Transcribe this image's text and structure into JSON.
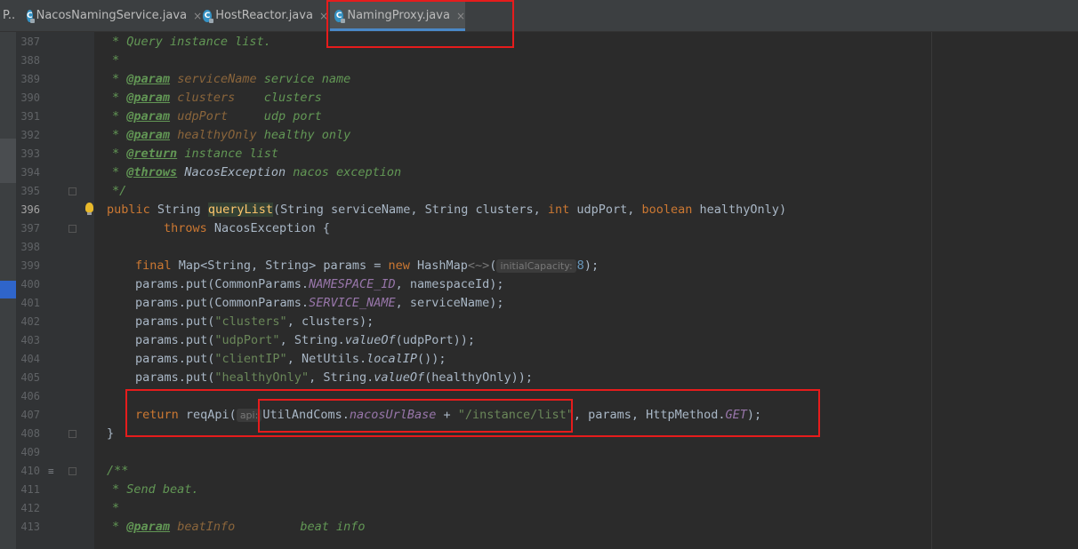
{
  "tabs": [
    {
      "label": "P..",
      "truncated": true,
      "active": false
    },
    {
      "label": "NacosNamingService.java",
      "icon": "java-class-icon",
      "close": "×",
      "active": false
    },
    {
      "label": "HostReactor.java",
      "icon": "java-class-icon",
      "close": "×",
      "active": false
    },
    {
      "label": "NamingProxy.java",
      "icon": "java-class-icon",
      "close": "×",
      "active": true
    }
  ],
  "icon_letter": "C",
  "line_numbers": [
    "387",
    "388",
    "389",
    "390",
    "391",
    "392",
    "393",
    "394",
    "395",
    "396",
    "397",
    "398",
    "399",
    "400",
    "401",
    "402",
    "403",
    "404",
    "405",
    "406",
    "407",
    "408",
    "409",
    "410",
    "411",
    "412",
    "413"
  ],
  "current_line": "396",
  "code": {
    "l387": "* Query instance list.",
    "l388": "*",
    "l389": {
      "star": "* ",
      "tag": "@param",
      "name": "serviceName",
      "desc": "service name"
    },
    "l390": {
      "star": "* ",
      "tag": "@param",
      "name": "clusters   ",
      "desc": "clusters"
    },
    "l391": {
      "star": "* ",
      "tag": "@param",
      "name": "udpPort    ",
      "desc": "udp port"
    },
    "l392": {
      "star": "* ",
      "tag": "@param",
      "name": "healthyOnly",
      "desc": "healthy only"
    },
    "l393": {
      "star": "* ",
      "tag": "@return",
      "desc": "instance list"
    },
    "l394": {
      "star": "* ",
      "tag": "@throws",
      "name": "NacosException",
      "desc": "nacos exception"
    },
    "l395": "*/",
    "l396": {
      "kw1": "public",
      "t1": " String ",
      "fn": "queryList",
      "t2": "(String serviceName, String clusters, ",
      "kw2": "int",
      "t3": " udpPort, ",
      "kw3": "boolean",
      "t4": " healthyOnly)"
    },
    "l397": {
      "kw": "throws",
      "t": " NacosException {"
    },
    "l399": {
      "kw1": "final",
      "t1": " Map<String, String> params = ",
      "kw2": "new",
      "t2": " HashMap",
      "diamond": "<~>",
      "t3": "(",
      "hint": "initialCapacity:",
      "num": "8",
      "t4": ");"
    },
    "l400": {
      "t1": "params.put(CommonParams.",
      "sf": "NAMESPACE_ID",
      "t2": ", namespaceId);"
    },
    "l401": {
      "t1": "params.put(CommonParams.",
      "sf": "SERVICE_NAME",
      "t2": ", serviceName);"
    },
    "l402": {
      "t1": "params.put(",
      "s": "\"clusters\"",
      "t2": ", clusters);"
    },
    "l403": {
      "t1": "params.put(",
      "s": "\"udpPort\"",
      "t2": ", String.",
      "si": "valueOf",
      "t3": "(udpPort));"
    },
    "l404": {
      "t1": "params.put(",
      "s": "\"clientIP\"",
      "t2": ", NetUtils.",
      "si": "localIP",
      "t3": "());"
    },
    "l405": {
      "t1": "params.put(",
      "s": "\"healthyOnly\"",
      "t2": ", String.",
      "si": "valueOf",
      "t3": "(healthyOnly));"
    },
    "l407": {
      "kw": "return",
      "t1": " reqApi(",
      "hint": "api:",
      "t2": "UtilAndComs.",
      "sf": "nacosUrlBase",
      "t3": " + ",
      "s": "\"/instance/list\"",
      "t4": ", params, HttpMethod.",
      "sf2": "GET",
      "t5": ");"
    },
    "l408": "}",
    "l410": "/**",
    "l411": "* Send beat.",
    "l412": "*",
    "l413": {
      "star": "* ",
      "tag": "@param",
      "name": "beatInfo        ",
      "desc": "beat info"
    }
  },
  "colors": {
    "highlight_box": "#e61c1c",
    "keyword": "#cc7832",
    "comment": "#629755",
    "string": "#6a8759",
    "static_field": "#9876aa",
    "number": "#6897bb",
    "method_decl": "#ffc66d"
  }
}
